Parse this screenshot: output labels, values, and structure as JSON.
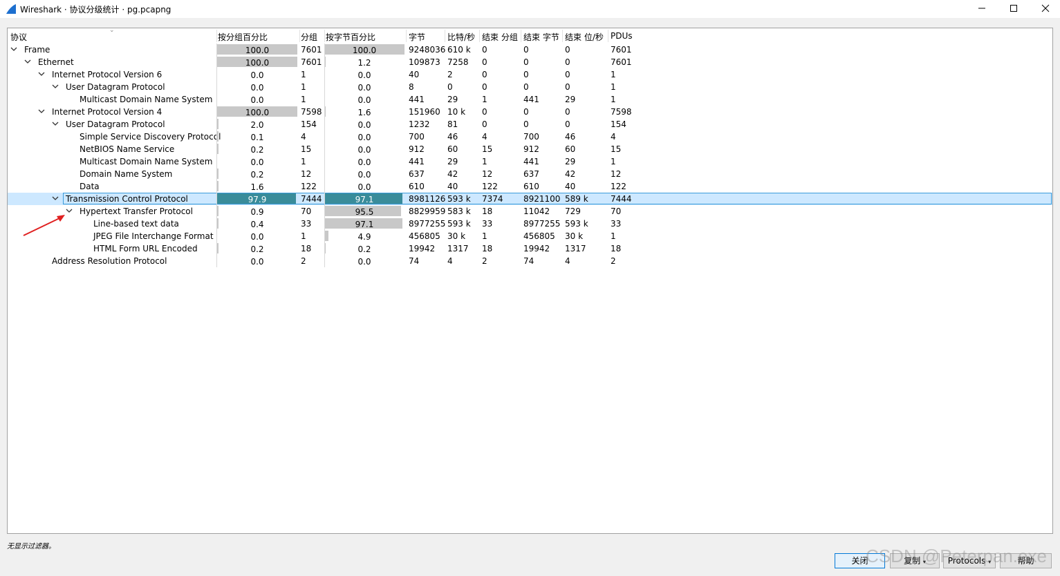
{
  "window": {
    "title": "Wireshark · 协议分级统计 · pg.pcapng",
    "min_label": "—",
    "max_label": "☐",
    "close_label": "✕"
  },
  "columns": [
    "协议",
    "按分组百分比",
    "分组",
    "按字节百分比",
    "字节",
    "比特/秒",
    "结束 分组",
    "结束 字节",
    "结束 位/秒",
    "PDUs"
  ],
  "rows": [
    {
      "name": "Frame",
      "level": 0,
      "expanded": true,
      "pkt_pct": "100.0",
      "pkt_frac": 1.0,
      "packets": "7601",
      "byte_pct": "100.0",
      "byte_frac": 1.0,
      "bytes": "9248036",
      "bps": "610 k",
      "end_pkts": "0",
      "end_bytes": "0",
      "end_bps": "0",
      "pdus": "7601"
    },
    {
      "name": "Ethernet",
      "level": 1,
      "expanded": true,
      "pkt_pct": "100.0",
      "pkt_frac": 1.0,
      "packets": "7601",
      "byte_pct": "1.2",
      "byte_frac": 0.012,
      "bytes": "109873",
      "bps": "7258",
      "end_pkts": "0",
      "end_bytes": "0",
      "end_bps": "0",
      "pdus": "7601"
    },
    {
      "name": "Internet Protocol Version 6",
      "level": 2,
      "expanded": true,
      "pkt_pct": "0.0",
      "pkt_frac": 0.0,
      "packets": "1",
      "byte_pct": "0.0",
      "byte_frac": 0.0,
      "bytes": "40",
      "bps": "2",
      "end_pkts": "0",
      "end_bytes": "0",
      "end_bps": "0",
      "pdus": "1"
    },
    {
      "name": "User Datagram Protocol",
      "level": 3,
      "expanded": true,
      "pkt_pct": "0.0",
      "pkt_frac": 0.0,
      "packets": "1",
      "byte_pct": "0.0",
      "byte_frac": 0.0,
      "bytes": "8",
      "bps": "0",
      "end_pkts": "0",
      "end_bytes": "0",
      "end_bps": "0",
      "pdus": "1"
    },
    {
      "name": "Multicast Domain Name System",
      "level": 4,
      "expanded": null,
      "pkt_pct": "0.0",
      "pkt_frac": 0.0,
      "packets": "1",
      "byte_pct": "0.0",
      "byte_frac": 0.0,
      "bytes": "441",
      "bps": "29",
      "end_pkts": "1",
      "end_bytes": "441",
      "end_bps": "29",
      "pdus": "1"
    },
    {
      "name": "Internet Protocol Version 4",
      "level": 2,
      "expanded": true,
      "pkt_pct": "100.0",
      "pkt_frac": 1.0,
      "packets": "7598",
      "byte_pct": "1.6",
      "byte_frac": 0.016,
      "bytes": "151960",
      "bps": "10 k",
      "end_pkts": "0",
      "end_bytes": "0",
      "end_bps": "0",
      "pdus": "7598"
    },
    {
      "name": "User Datagram Protocol",
      "level": 3,
      "expanded": true,
      "pkt_pct": "2.0",
      "pkt_frac": 0.02,
      "packets": "154",
      "byte_pct": "0.0",
      "byte_frac": 0.0,
      "bytes": "1232",
      "bps": "81",
      "end_pkts": "0",
      "end_bytes": "0",
      "end_bps": "0",
      "pdus": "154"
    },
    {
      "name": "Simple Service Discovery Protocol",
      "level": 4,
      "expanded": null,
      "pkt_pct": "0.1",
      "pkt_frac": 0.001,
      "packets": "4",
      "byte_pct": "0.0",
      "byte_frac": 0.0,
      "bytes": "700",
      "bps": "46",
      "end_pkts": "4",
      "end_bytes": "700",
      "end_bps": "46",
      "pdus": "4"
    },
    {
      "name": "NetBIOS Name Service",
      "level": 4,
      "expanded": null,
      "pkt_pct": "0.2",
      "pkt_frac": 0.002,
      "packets": "15",
      "byte_pct": "0.0",
      "byte_frac": 0.0,
      "bytes": "912",
      "bps": "60",
      "end_pkts": "15",
      "end_bytes": "912",
      "end_bps": "60",
      "pdus": "15"
    },
    {
      "name": "Multicast Domain Name System",
      "level": 4,
      "expanded": null,
      "pkt_pct": "0.0",
      "pkt_frac": 0.0,
      "packets": "1",
      "byte_pct": "0.0",
      "byte_frac": 0.0,
      "bytes": "441",
      "bps": "29",
      "end_pkts": "1",
      "end_bytes": "441",
      "end_bps": "29",
      "pdus": "1"
    },
    {
      "name": "Domain Name System",
      "level": 4,
      "expanded": null,
      "pkt_pct": "0.2",
      "pkt_frac": 0.002,
      "packets": "12",
      "byte_pct": "0.0",
      "byte_frac": 0.0,
      "bytes": "637",
      "bps": "42",
      "end_pkts": "12",
      "end_bytes": "637",
      "end_bps": "42",
      "pdus": "12"
    },
    {
      "name": "Data",
      "level": 4,
      "expanded": null,
      "pkt_pct": "1.6",
      "pkt_frac": 0.016,
      "packets": "122",
      "byte_pct": "0.0",
      "byte_frac": 0.0,
      "bytes": "610",
      "bps": "40",
      "end_pkts": "122",
      "end_bytes": "610",
      "end_bps": "40",
      "pdus": "122"
    },
    {
      "name": "Transmission Control Protocol",
      "level": 3,
      "expanded": true,
      "selected": true,
      "pkt_pct": "97.9",
      "pkt_frac": 0.979,
      "packets": "7444",
      "byte_pct": "97.1",
      "byte_frac": 0.971,
      "bytes": "8981126",
      "bps": "593 k",
      "end_pkts": "7374",
      "end_bytes": "8921100",
      "end_bps": "589 k",
      "pdus": "7444"
    },
    {
      "name": "Hypertext Transfer Protocol",
      "level": 4,
      "expanded": true,
      "pkt_pct": "0.9",
      "pkt_frac": 0.009,
      "packets": "70",
      "byte_pct": "95.5",
      "byte_frac": 0.955,
      "bytes": "8829959",
      "bps": "583 k",
      "end_pkts": "18",
      "end_bytes": "11042",
      "end_bps": "729",
      "pdus": "70"
    },
    {
      "name": "Line-based text data",
      "level": 5,
      "expanded": null,
      "pkt_pct": "0.4",
      "pkt_frac": 0.004,
      "packets": "33",
      "byte_pct": "97.1",
      "byte_frac": 0.971,
      "bytes": "8977255",
      "bps": "593 k",
      "end_pkts": "33",
      "end_bytes": "8977255",
      "end_bps": "593 k",
      "pdus": "33"
    },
    {
      "name": "JPEG File Interchange Format",
      "level": 5,
      "expanded": null,
      "pkt_pct": "0.0",
      "pkt_frac": 0.0,
      "packets": "1",
      "byte_pct": "4.9",
      "byte_frac": 0.049,
      "bytes": "456805",
      "bps": "30 k",
      "end_pkts": "1",
      "end_bytes": "456805",
      "end_bps": "30 k",
      "pdus": "1"
    },
    {
      "name": "HTML Form URL Encoded",
      "level": 5,
      "expanded": null,
      "pkt_pct": "0.2",
      "pkt_frac": 0.002,
      "packets": "18",
      "byte_pct": "0.2",
      "byte_frac": 0.002,
      "bytes": "19942",
      "bps": "1317",
      "end_pkts": "18",
      "end_bytes": "19942",
      "end_bps": "1317",
      "pdus": "18"
    },
    {
      "name": "Address Resolution Protocol",
      "level": 2,
      "expanded": null,
      "pkt_pct": "0.0",
      "pkt_frac": 0.0,
      "packets": "2",
      "byte_pct": "0.0",
      "byte_frac": 0.0,
      "bytes": "74",
      "bps": "4",
      "end_pkts": "2",
      "end_bytes": "74",
      "end_bps": "4",
      "pdus": "2"
    }
  ],
  "status_text": "无显示过滤器。",
  "buttons": {
    "close": "关闭",
    "copy": "复制",
    "protocols": "Protocols",
    "help": "帮助"
  },
  "watermark": "CSDN @Peterpan.exe",
  "colors": {
    "selection_bg": "#cde8ff",
    "selection_border": "#3a9bd9",
    "bar_default": "#c8c8c8",
    "bar_selected": "#3a8c9a",
    "annotation_arrow": "#e02020"
  }
}
